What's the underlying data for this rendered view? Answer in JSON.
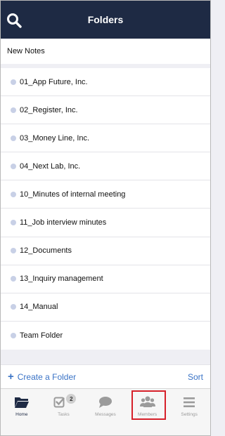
{
  "header": {
    "title": "Folders"
  },
  "new_notes": {
    "label": "New Notes"
  },
  "folders": [
    "01_App Future, Inc.",
    "02_Register, Inc.",
    "03_Money Line, Inc.",
    "04_Next Lab, Inc.",
    "10_Minutes of internal meeting",
    "11_Job interview minutes",
    "12_Documents",
    "13_Inquiry management",
    "14_Manual",
    "Team Folder"
  ],
  "actions": {
    "create_label": "Create a Folder",
    "sort_label": "Sort"
  },
  "tabs": [
    {
      "label": "Home",
      "icon": "folder-open-icon",
      "active": true
    },
    {
      "label": "Tasks",
      "icon": "checkbox-icon",
      "badge": "2"
    },
    {
      "label": "Messages",
      "icon": "chat-bubble-icon"
    },
    {
      "label": "Members",
      "icon": "users-icon",
      "highlighted": true
    },
    {
      "label": "Settings",
      "icon": "menu-icon"
    }
  ],
  "colors": {
    "header_bg": "#1e2a44",
    "accent": "#3a73c6",
    "dot": "#c8d0e6",
    "highlight": "#d6202a"
  }
}
